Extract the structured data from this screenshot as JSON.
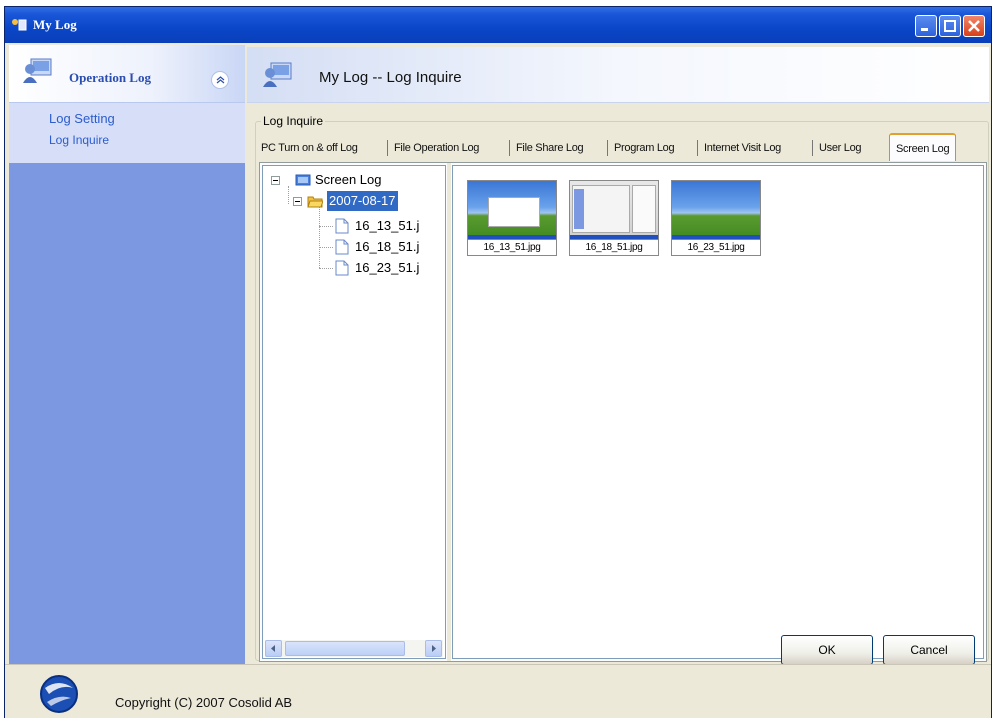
{
  "window": {
    "title": "My Log"
  },
  "sidebar": {
    "section_title": "Operation Log",
    "links": [
      "Log Setting",
      "Log Inquire"
    ]
  },
  "main": {
    "header_title": "My Log -- Log Inquire",
    "group_label": "Log Inquire",
    "tabs": [
      "PC Turn on & off Log",
      "File Operation Log",
      "File Share Log",
      "Program Log",
      "Internet Visit Log",
      "User Log",
      "Screen Log"
    ],
    "active_tab": "Screen Log",
    "tree": {
      "root": "Screen Log",
      "folder": "2007-08-17",
      "files": [
        "16_13_51.j",
        "16_18_51.j",
        "16_23_51.j"
      ]
    },
    "thumbnails": [
      "16_13_51.jpg",
      "16_18_51.jpg",
      "16_23_51.jpg"
    ],
    "buttons": {
      "ok": "OK",
      "cancel": "Cancel"
    }
  },
  "statusbar": {
    "copyright": "Copyright (C) 2007 Cosolid AB"
  },
  "colors": {
    "titlebar": "#0a46c8",
    "sidebar": "#7c98e0",
    "selection": "#316ac5",
    "link": "#2c5ccf"
  }
}
